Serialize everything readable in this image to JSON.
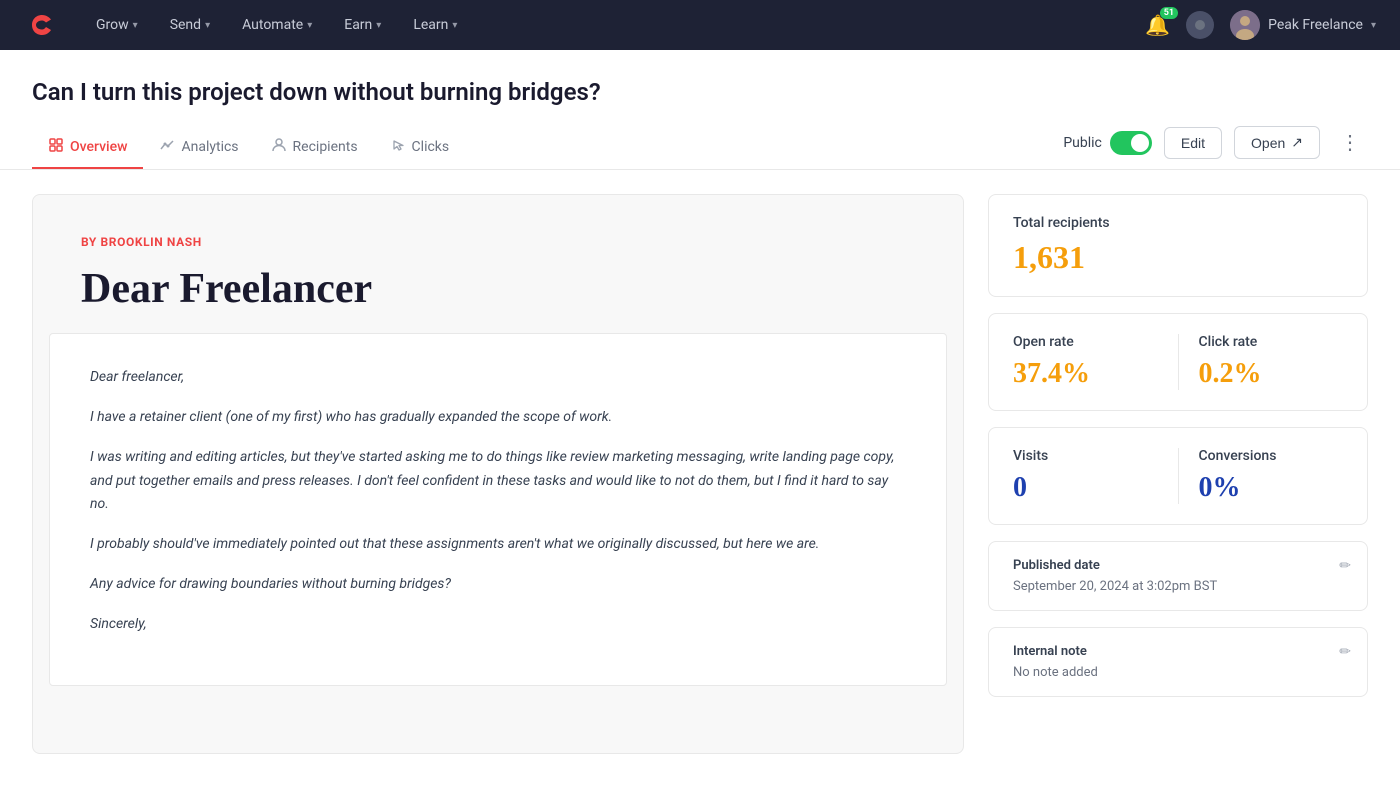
{
  "navbar": {
    "brand": "ConvertKit",
    "items": [
      {
        "label": "Grow",
        "id": "grow"
      },
      {
        "label": "Send",
        "id": "send"
      },
      {
        "label": "Automate",
        "id": "automate"
      },
      {
        "label": "Earn",
        "id": "earn"
      },
      {
        "label": "Learn",
        "id": "learn"
      }
    ],
    "notification_count": "51",
    "user_name": "Peak Freelance"
  },
  "page": {
    "title": "Can I turn this project down without burning bridges?",
    "tabs": [
      {
        "label": "Overview",
        "icon": "✎",
        "active": true
      },
      {
        "label": "Analytics",
        "icon": "📊",
        "active": false
      },
      {
        "label": "Recipients",
        "icon": "👥",
        "active": false
      },
      {
        "label": "Clicks",
        "icon": "👆",
        "active": false
      }
    ],
    "actions": {
      "public_label": "Public",
      "edit_label": "Edit",
      "open_label": "Open"
    }
  },
  "article": {
    "byline": "BY BROOKLIN NASH",
    "title": "Dear Freelancer",
    "paragraphs": [
      "Dear freelancer,",
      "I have a retainer client (one of my first) who has gradually expanded the scope of work.",
      "I was writing and editing articles, but they've started asking me to do things like review marketing messaging, write landing page copy, and put together emails and press releases. I don't feel confident in these tasks and would like to not do them, but I find it hard to say no.",
      "I probably should've immediately pointed out that these assignments aren't what we originally discussed, but here we are.",
      "Any advice for drawing boundaries without burning bridges?",
      "Sincerely,"
    ]
  },
  "stats": {
    "total_recipients_label": "Total recipients",
    "total_recipients_value": "1,631",
    "open_rate_label": "Open rate",
    "open_rate_value": "37.4%",
    "click_rate_label": "Click rate",
    "click_rate_value": "0.2%",
    "visits_label": "Visits",
    "visits_value": "0",
    "conversions_label": "Conversions",
    "conversions_value": "0%",
    "published_date_label": "Published date",
    "published_date_value": "September 20, 2024 at 3:02pm BST",
    "internal_note_label": "Internal note",
    "internal_note_value": "No note added"
  }
}
